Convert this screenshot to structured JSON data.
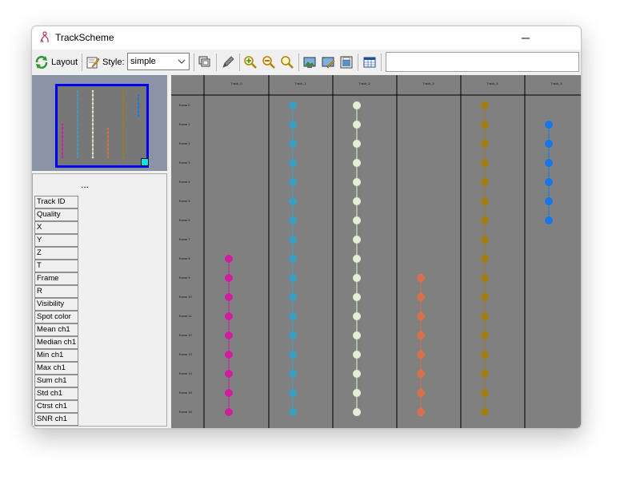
{
  "window": {
    "title": "TrackScheme"
  },
  "toolbar": {
    "layout_label": "Layout",
    "style_label": "Style:",
    "style_value": "simple",
    "search_value": ""
  },
  "features": {
    "ellipsis": "...",
    "items": [
      "Track ID",
      "Quality",
      "X",
      "Y",
      "Z",
      "T",
      "Frame",
      "R",
      "Visibility",
      "Spot color",
      "Mean ch1",
      "Median ch1",
      "Min ch1",
      "Max ch1",
      "Sum ch1",
      "Std ch1",
      "Ctrst ch1",
      "SNR ch1"
    ]
  },
  "tracks": [
    {
      "name": "Track_0",
      "color": "#cc1e9e",
      "spots": [
        8,
        9,
        10,
        11,
        12,
        13,
        14,
        15,
        16
      ]
    },
    {
      "name": "Track_1",
      "color": "#3a9fc2",
      "spots": [
        0,
        1,
        2,
        3,
        4,
        5,
        6,
        7,
        8,
        9,
        10,
        11,
        12,
        13,
        14,
        15,
        16
      ]
    },
    {
      "name": "Track_2",
      "color": "#e4f0d6",
      "spots": [
        0,
        1,
        2,
        3,
        4,
        5,
        6,
        7,
        8,
        9,
        10,
        11,
        12,
        13,
        14,
        15,
        16
      ]
    },
    {
      "name": "Track_3",
      "color": "#d8704a",
      "spots": [
        9,
        10,
        11,
        12,
        13,
        14,
        15,
        16
      ]
    },
    {
      "name": "Track_4",
      "color": "#a07e12",
      "spots": [
        0,
        1,
        2,
        3,
        4,
        5,
        6,
        7,
        8,
        9,
        10,
        11,
        12,
        13,
        14,
        15,
        16
      ]
    },
    {
      "name": "Track_5",
      "color": "#1a76e6",
      "spots": [
        1,
        2,
        3,
        4,
        5,
        6
      ]
    }
  ],
  "frames": [
    "frame 0",
    "frame 1",
    "frame 2",
    "frame 3",
    "frame 4",
    "frame 5",
    "frame 6",
    "frame 7",
    "frame 8",
    "frame 9",
    "frame 10",
    "frame 11",
    "frame 12",
    "frame 13",
    "frame 14",
    "frame 15",
    "frame 16"
  ]
}
